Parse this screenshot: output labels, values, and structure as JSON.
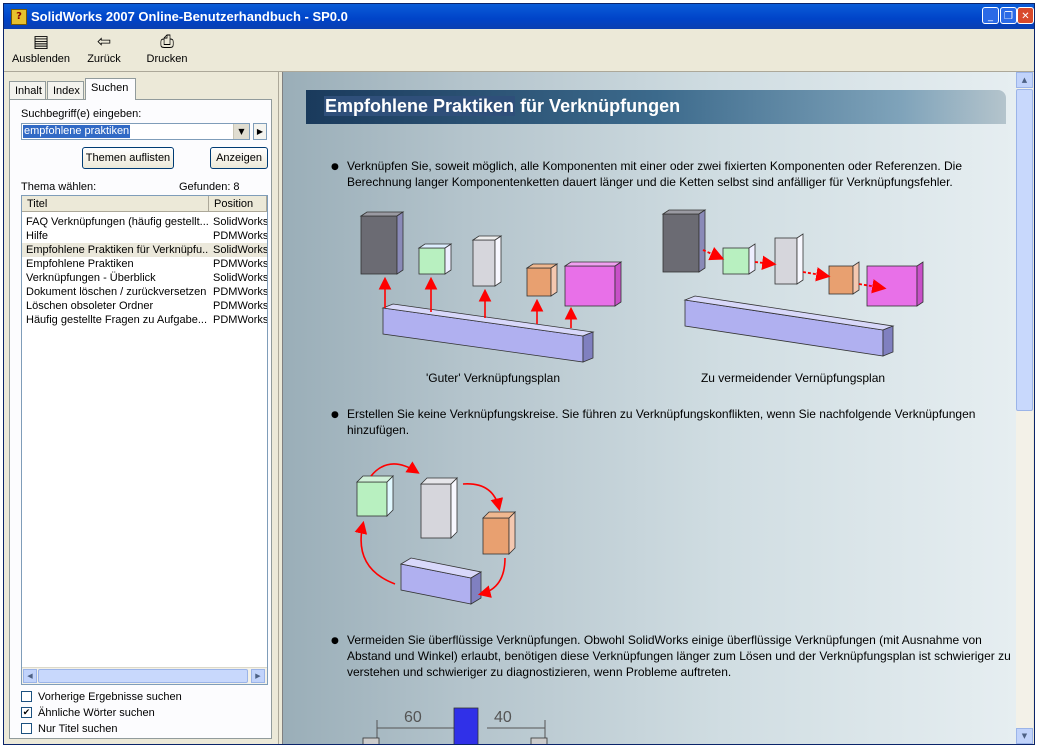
{
  "window": {
    "title": "SolidWorks 2007 Online-Benutzerhandbuch - SP0.0",
    "controls": [
      "minimize",
      "restore",
      "close"
    ]
  },
  "toolbar": {
    "hide_label": "Ausblenden",
    "back_label": "Zurück",
    "print_label": "Drucken"
  },
  "nav": {
    "tabs": [
      {
        "label": "Inhalt",
        "active": false
      },
      {
        "label": "Index",
        "active": false
      },
      {
        "label": "Suchen",
        "active": true
      }
    ]
  },
  "search": {
    "prompt_label": "Suchbegriff(e) eingeben:",
    "query": "empfohlene praktiken",
    "list_topics_button": "Themen auflisten",
    "display_button": "Anzeigen",
    "choose_topic_label": "Thema wählen:",
    "found_label": "Gefunden: 8",
    "columns": [
      "Titel",
      "Position"
    ],
    "results": [
      {
        "title": "FAQ Verknüpfungen (häufig gestellt...",
        "location": "SolidWorks"
      },
      {
        "title": "Hilfe",
        "location": "PDMWorks"
      },
      {
        "title": "Empfohlene Praktiken für Verknüpfu...",
        "location": "SolidWorks"
      },
      {
        "title": "Empfohlene Praktiken",
        "location": "PDMWorks"
      },
      {
        "title": "Verknüpfungen - Überblick",
        "location": "SolidWorks"
      },
      {
        "title": "Dokument löschen / zurückversetzen",
        "location": "PDMWorks"
      },
      {
        "title": "Löschen obsoleter Ordner",
        "location": "PDMWorks"
      },
      {
        "title": "Häufig gestellte Fragen zu Aufgabe...",
        "location": "PDMWorks"
      }
    ],
    "selected_index": 2,
    "options": [
      {
        "label": "Vorherige Ergebnisse suchen",
        "checked": false
      },
      {
        "label": "Ähnliche Wörter suchen",
        "checked": true
      },
      {
        "label": "Nur Titel suchen",
        "checked": false
      }
    ]
  },
  "article": {
    "title_highlight": "Empfohlene Praktiken",
    "title_rest": " für Verknüpfungen",
    "bullet1": "Verknüpfen Sie, soweit möglich, alle Komponenten mit einer oder zwei fixierten Komponenten oder Referenzen. Die Berechnung langer Komponentenketten dauert länger und die Ketten selbst sind anfälliger für Verknüpfungsfehler.",
    "caption_good": "'Guter' Verknüpfungsplan",
    "caption_bad": "Zu vermeidender Vernüpfungsplan",
    "bullet2": "Erstellen Sie keine Verknüpfungskreise. Sie führen zu Verknüpfungskonflikten, wenn Sie nachfolgende Verknüpfungen hinzufügen.",
    "bullet3": "Vermeiden Sie überflüssige Verknüpfungen. Obwohl SolidWorks einige überflüssige Verknüpfungen (mit Ausnahme von Abstand und Winkel) erlaubt, benötigen diese Verknüpfungen länger zum Lösen und der Verknüpfungsplan ist schwieriger zu verstehen und schwieriger zu diagnostizieren, wenn Probleme auftreten.",
    "dim_left": "60",
    "dim_right": "40"
  },
  "colors": {
    "arrow": "#ff0000",
    "block_dark": "#6b6b73",
    "block_green": "#b8f0c0",
    "block_gray": "#d6d6dc",
    "block_orange": "#e8a070",
    "block_magenta": "#e870e8",
    "block_base": "#b0b0f0"
  }
}
